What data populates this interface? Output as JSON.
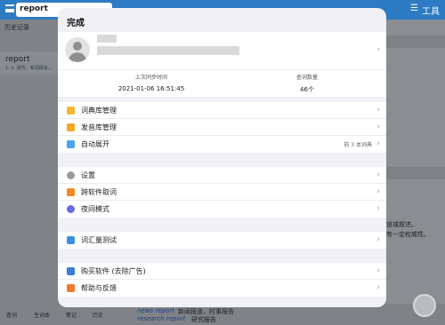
{
  "background": {
    "search_text": "report",
    "tools_label": "工具",
    "history_label": "历史记录",
    "history_item": {
      "word": "report",
      "snippet": "1. n. 报告；新闻报道..."
    },
    "right_snippets": [
      "道或叙述。",
      "有一定权威性。"
    ],
    "example_1_link": "news report",
    "example_1_text": "新闻报道，时事报告",
    "example_2_link": "research report",
    "example_2_text": "研究报告",
    "bottom_tabs": [
      "查词",
      "生词本",
      "笔记",
      "历史"
    ]
  },
  "modal": {
    "done_label": "完成",
    "stats": {
      "last_sync_label": "上次同步时间",
      "last_sync_value": "2021-01-06 16:51:45",
      "lookup_count_label": "查词数量",
      "lookup_count_value": "46个"
    },
    "groups": [
      [
        {
          "label": "词典库管理",
          "icon": "dictionary-icon",
          "color": "#f5b731",
          "value": ""
        },
        {
          "label": "发音库管理",
          "icon": "speaker-icon",
          "color": "#f5a623",
          "value": ""
        },
        {
          "label": "自动展开",
          "icon": "expand-icon",
          "color": "#4aa3f0",
          "value": "前 3 本词典"
        }
      ],
      [
        {
          "label": "设置",
          "icon": "gear-icon",
          "color": "#9b9b9b",
          "value": ""
        },
        {
          "label": "跨软件取词",
          "icon": "cross-app-icon",
          "color": "#f08a24",
          "value": ""
        },
        {
          "label": "夜间模式",
          "icon": "moon-icon",
          "color": "#6a6adf",
          "value": ""
        }
      ],
      [
        {
          "label": "词汇量测试",
          "icon": "test-icon",
          "color": "#3d8fe0",
          "value": ""
        }
      ],
      [
        {
          "label": "购买软件 (去除广告)",
          "icon": "key-icon",
          "color": "#3a7bd5",
          "value": ""
        },
        {
          "label": "帮助与反馈",
          "icon": "feedback-icon",
          "color": "#f0782a",
          "value": ""
        }
      ]
    ]
  }
}
